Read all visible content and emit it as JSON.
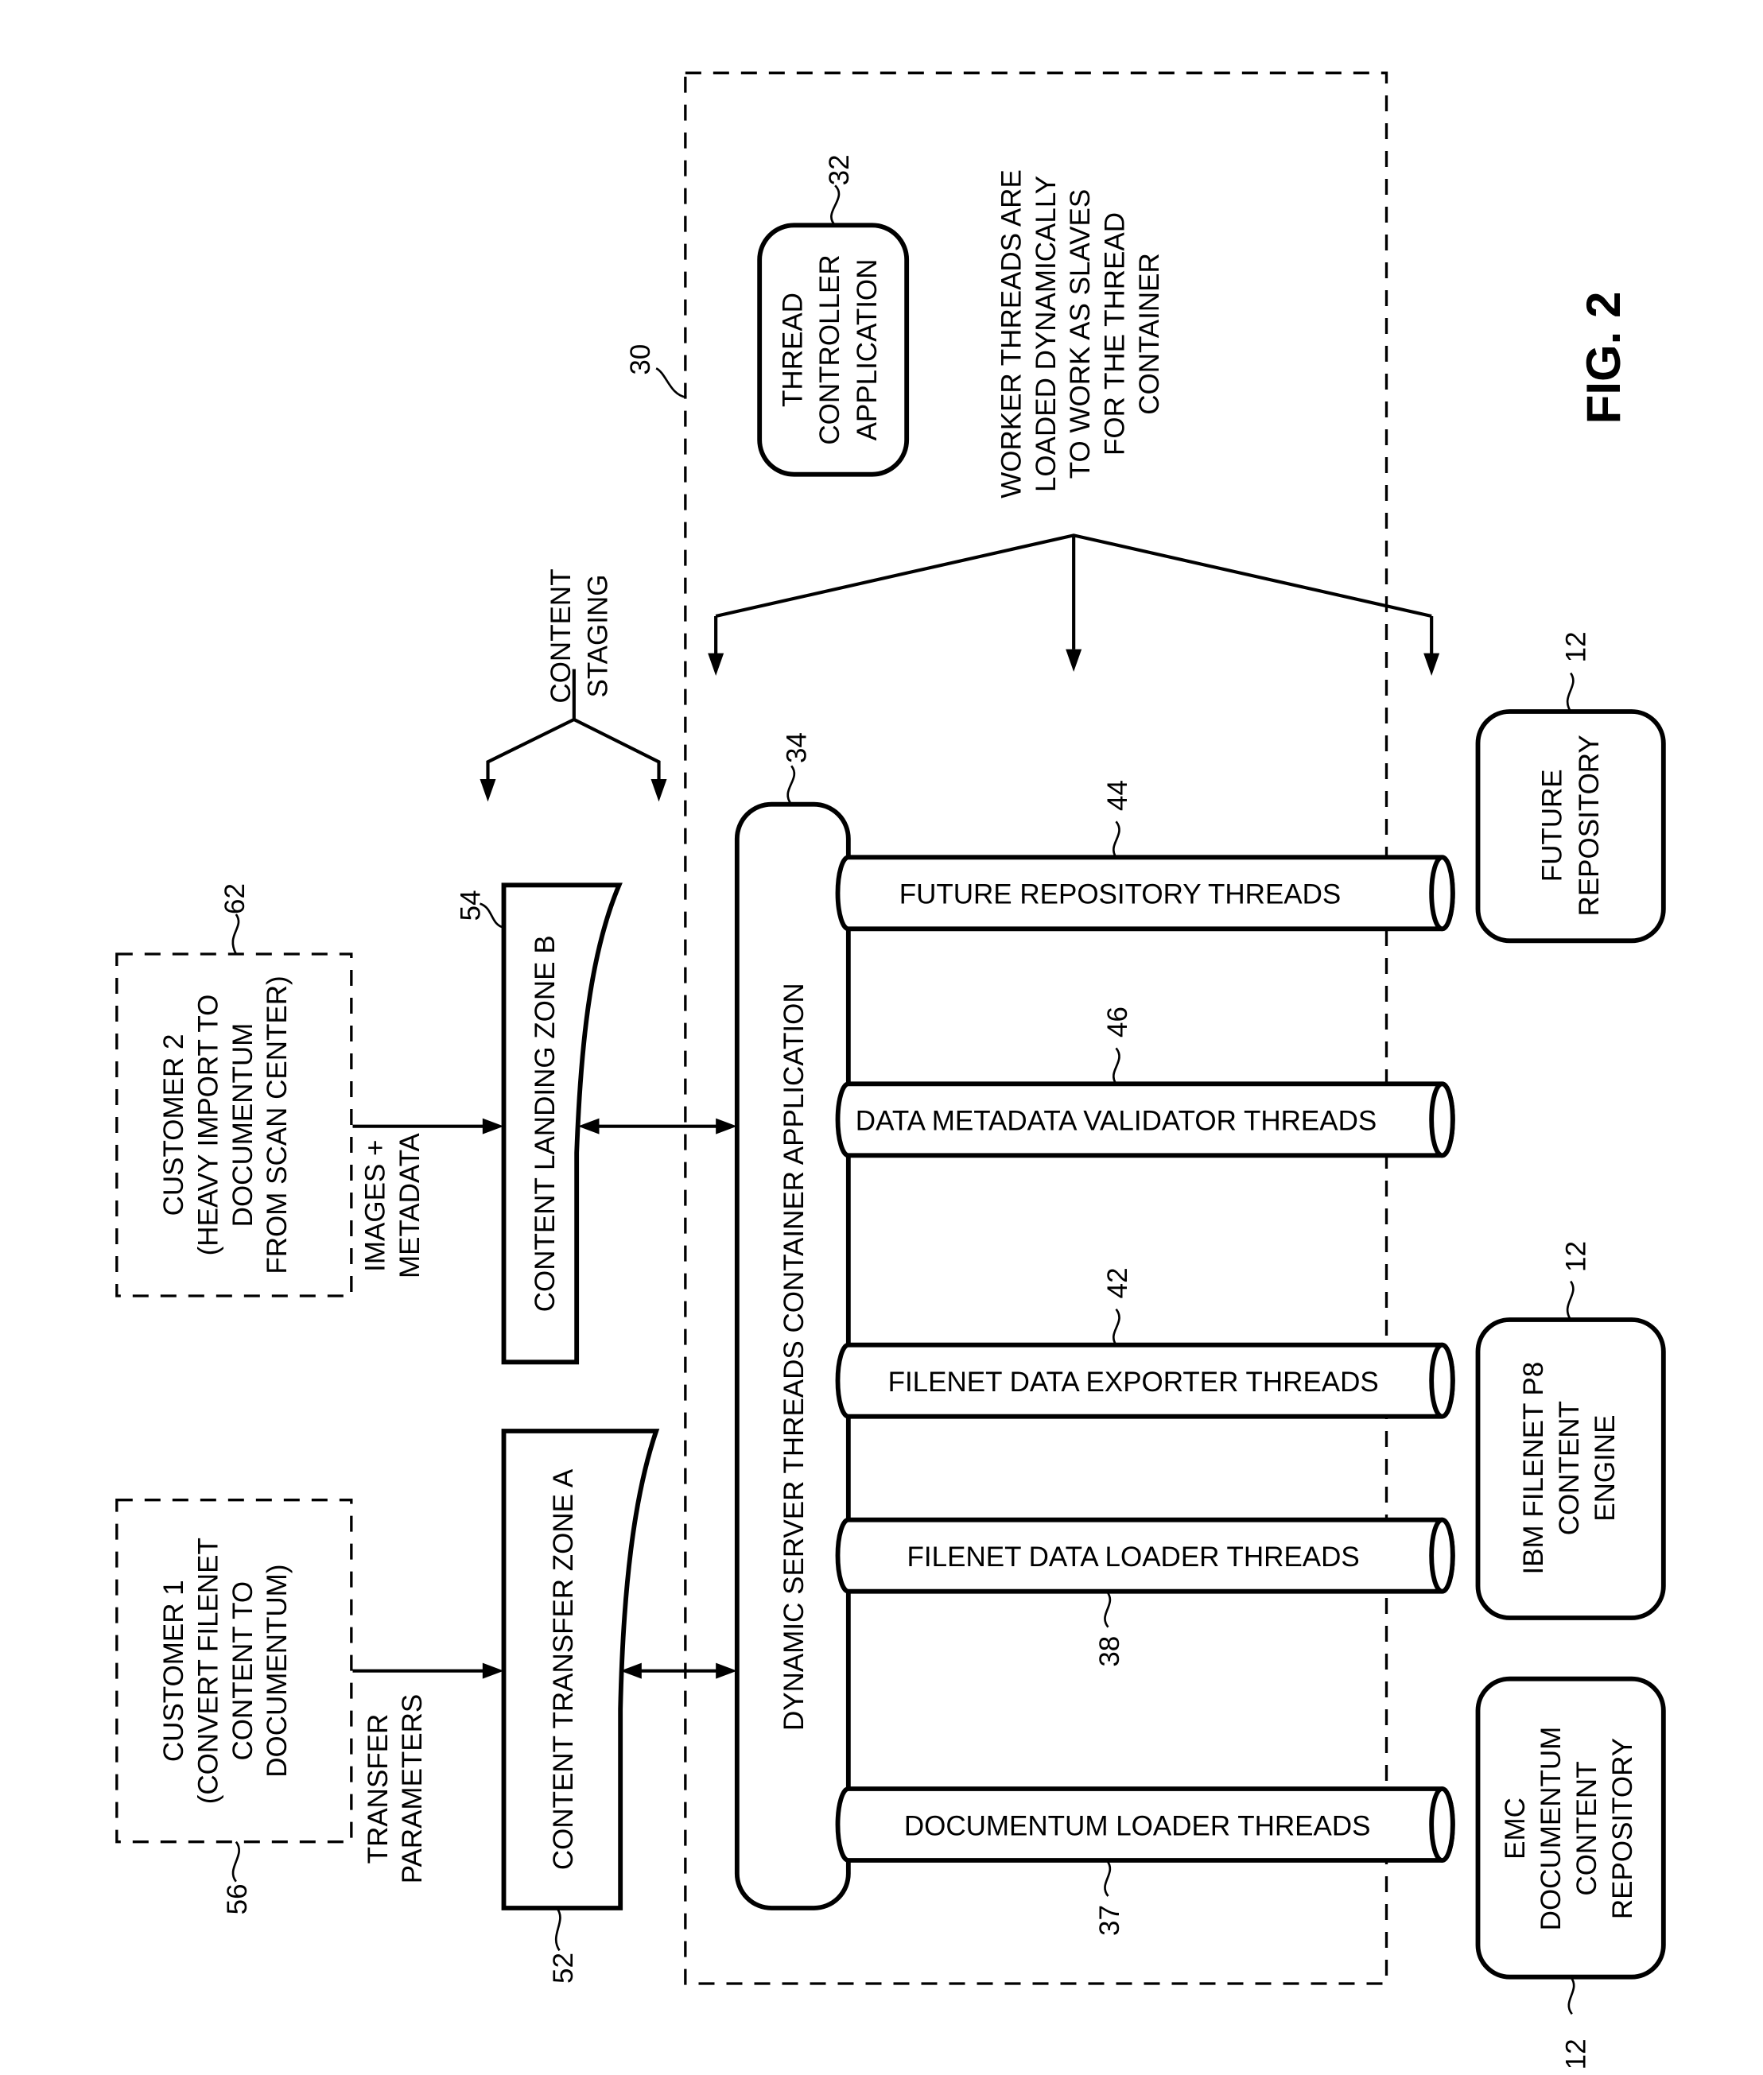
{
  "figure": {
    "title": "FIG. 2",
    "container": {
      "label": "30"
    },
    "thread_controller": {
      "ref": "32",
      "lines": [
        "THREAD",
        "CONTROLLER",
        "APPLICATION"
      ]
    },
    "worker_note": {
      "lines": [
        "WORKER THREADS ARE",
        "LOADED DYNAMICALLY",
        "TO WORK AS SLAVES",
        "FOR THE THREAD",
        "CONTAINER"
      ]
    },
    "content_staging": {
      "lines": [
        "CONTENT",
        "STAGING"
      ]
    },
    "container_app": {
      "ref": "34",
      "label": "DYNAMIC SERVER THREADS CONTAINER APPLICATION"
    },
    "customers": [
      {
        "ref": "62",
        "lines": [
          "CUSTOMER 2",
          "(HEAVY IMPORT TO",
          "DOCUMENTUM",
          "FROM SCAN CENTER)"
        ],
        "flow_label": [
          "IMAGES +",
          "METADATA"
        ]
      },
      {
        "ref": "56",
        "lines": [
          "CUSTOMER 1",
          "(CONVERT FILENET",
          "CONTENT TO",
          "DOCUMENTUM)"
        ],
        "flow_label": [
          "TRANSFER",
          "PARAMETERS"
        ]
      }
    ],
    "zones": [
      {
        "ref": "54",
        "label": "CONTENT LANDING ZONE B"
      },
      {
        "ref": "52",
        "label": "CONTENT TRANSFER ZONE A"
      }
    ],
    "threads": [
      {
        "ref": "44",
        "label": "FUTURE REPOSITORY THREADS"
      },
      {
        "ref": "46",
        "label": "DATA METADATA VALIDATOR THREADS"
      },
      {
        "ref": "42",
        "label": "FILENET DATA EXPORTER THREADS"
      },
      {
        "ref": "38",
        "label": "FILENET DATA LOADER THREADS"
      },
      {
        "ref": "37",
        "label": "DOCUMENTUM LOADER THREADS"
      }
    ],
    "repositories": [
      {
        "ref": "12",
        "lines": [
          "FUTURE",
          "REPOSITORY"
        ]
      },
      {
        "ref": "12",
        "lines": [
          "IBM FILENET P8",
          "CONTENT",
          "ENGINE"
        ]
      },
      {
        "ref": "12",
        "lines": [
          "EMC",
          "DOCUMENTUM",
          "CONTENT",
          "REPOSITORY"
        ]
      }
    ]
  }
}
